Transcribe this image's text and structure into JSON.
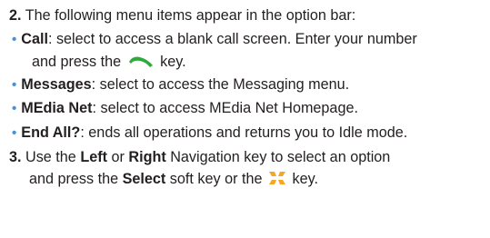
{
  "step2": {
    "number": "2.",
    "text": "The following menu items appear in the option bar:"
  },
  "items": [
    {
      "term": "Call",
      "desc": ": select to access a blank call screen.  Enter your number",
      "cont_before": "and press the",
      "cont_after": "key."
    },
    {
      "term": "Messages",
      "desc": ": select to access the Messaging menu."
    },
    {
      "term": "MEdia Net",
      "desc": ": select to access MEdia Net Homepage."
    },
    {
      "term": "End All?",
      "desc": ": ends all operations and returns you to Idle mode."
    }
  ],
  "step3": {
    "number": "3.",
    "line1_a": "Use the ",
    "left": "Left",
    "line1_b": " or ",
    "right": "Right",
    "line1_c": " Navigation key to select an option",
    "line2_a": "and press the ",
    "select": "Select",
    "line2_b": " soft key or the",
    "line2_c": "key."
  },
  "icons": {
    "call": "send-call-key-icon",
    "menu": "menu-ok-key-icon",
    "call_color": "#2eaa3c",
    "menu_color": "#f5a623",
    "bullet_color": "#4a90d9"
  }
}
